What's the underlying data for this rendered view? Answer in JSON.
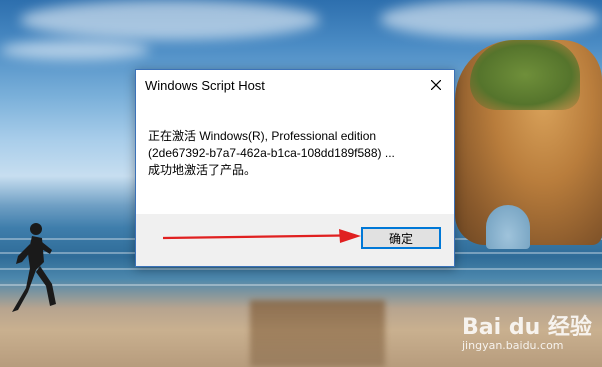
{
  "dialog": {
    "title": "Windows Script Host",
    "lines": [
      "正在激活 Windows(R), Professional edition",
      "(2de67392-b7a7-462a-b1ca-108dd189f588) ...",
      "成功地激活了产品。"
    ],
    "ok_label": "确定"
  },
  "watermark": {
    "logo": "Bai du 经验",
    "url": "jingyan.baidu.com"
  },
  "colors": {
    "accent": "#0078d7",
    "dialog_border": "#3c72b8",
    "arrow": "#e02020",
    "footer_bg": "#f0f0f0"
  }
}
